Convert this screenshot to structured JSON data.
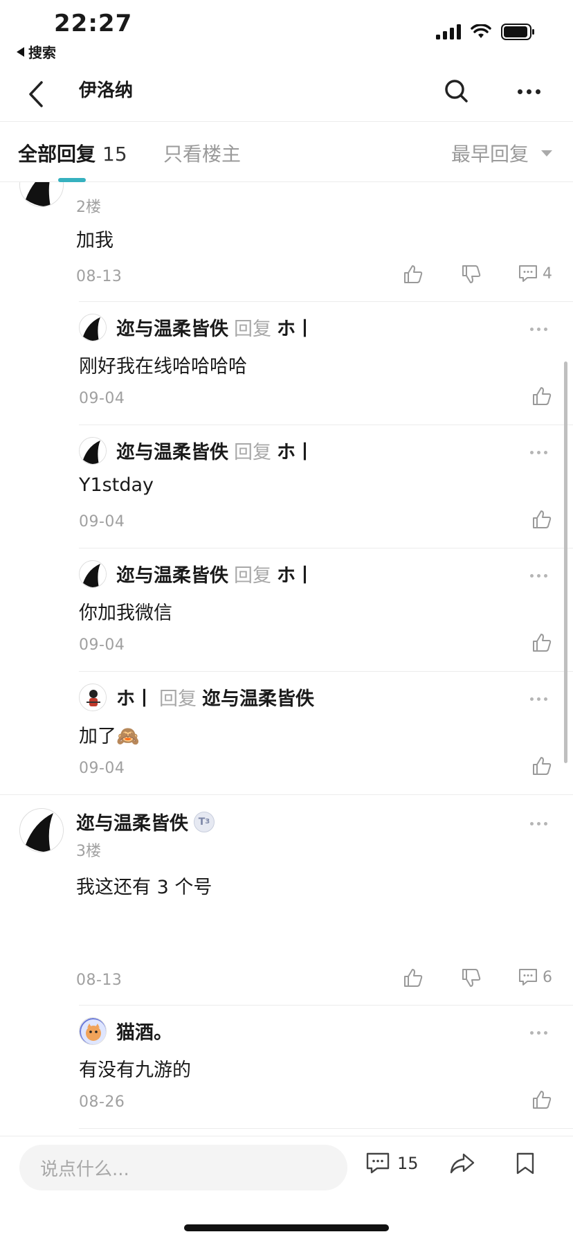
{
  "status_bar": {
    "time": "22:27",
    "back_app": "搜索"
  },
  "nav": {
    "title": "伊洛纳"
  },
  "tabs": {
    "all_label": "全部回复",
    "all_count": "15",
    "op_only": "只看楼主",
    "sort_label": "最早回复"
  },
  "posts": [
    {
      "floor": "2楼",
      "content": "加我",
      "date": "08-13",
      "comment_count": "4",
      "replies": [
        {
          "author": "迩与温柔皆佚",
          "reply_word": "回复",
          "reply_to": "ホ丨",
          "text": "刚好我在线哈哈哈哈",
          "date": "09-04"
        },
        {
          "author": "迩与温柔皆佚",
          "reply_word": "回复",
          "reply_to": "ホ丨",
          "text": "Y1stday",
          "date": "09-04"
        },
        {
          "author": "迩与温柔皆佚",
          "reply_word": "回复",
          "reply_to": "ホ丨",
          "text": "你加我微信",
          "date": "09-04"
        },
        {
          "author": "ホ丨",
          "reply_word": "回复",
          "reply_to": "迩与温柔皆佚",
          "text": "加了🙈",
          "date": "09-04"
        }
      ]
    },
    {
      "author": "迩与温柔皆佚",
      "level": "3",
      "floor": "3楼",
      "content": "我这还有 3 个号",
      "date": "08-13",
      "comment_count": "6",
      "replies": [
        {
          "author": "猫酒。",
          "text": "有没有九游的",
          "date": "08-26"
        }
      ]
    }
  ],
  "bottom_bar": {
    "input_placeholder": "说点什么...",
    "comment_count": "15"
  }
}
